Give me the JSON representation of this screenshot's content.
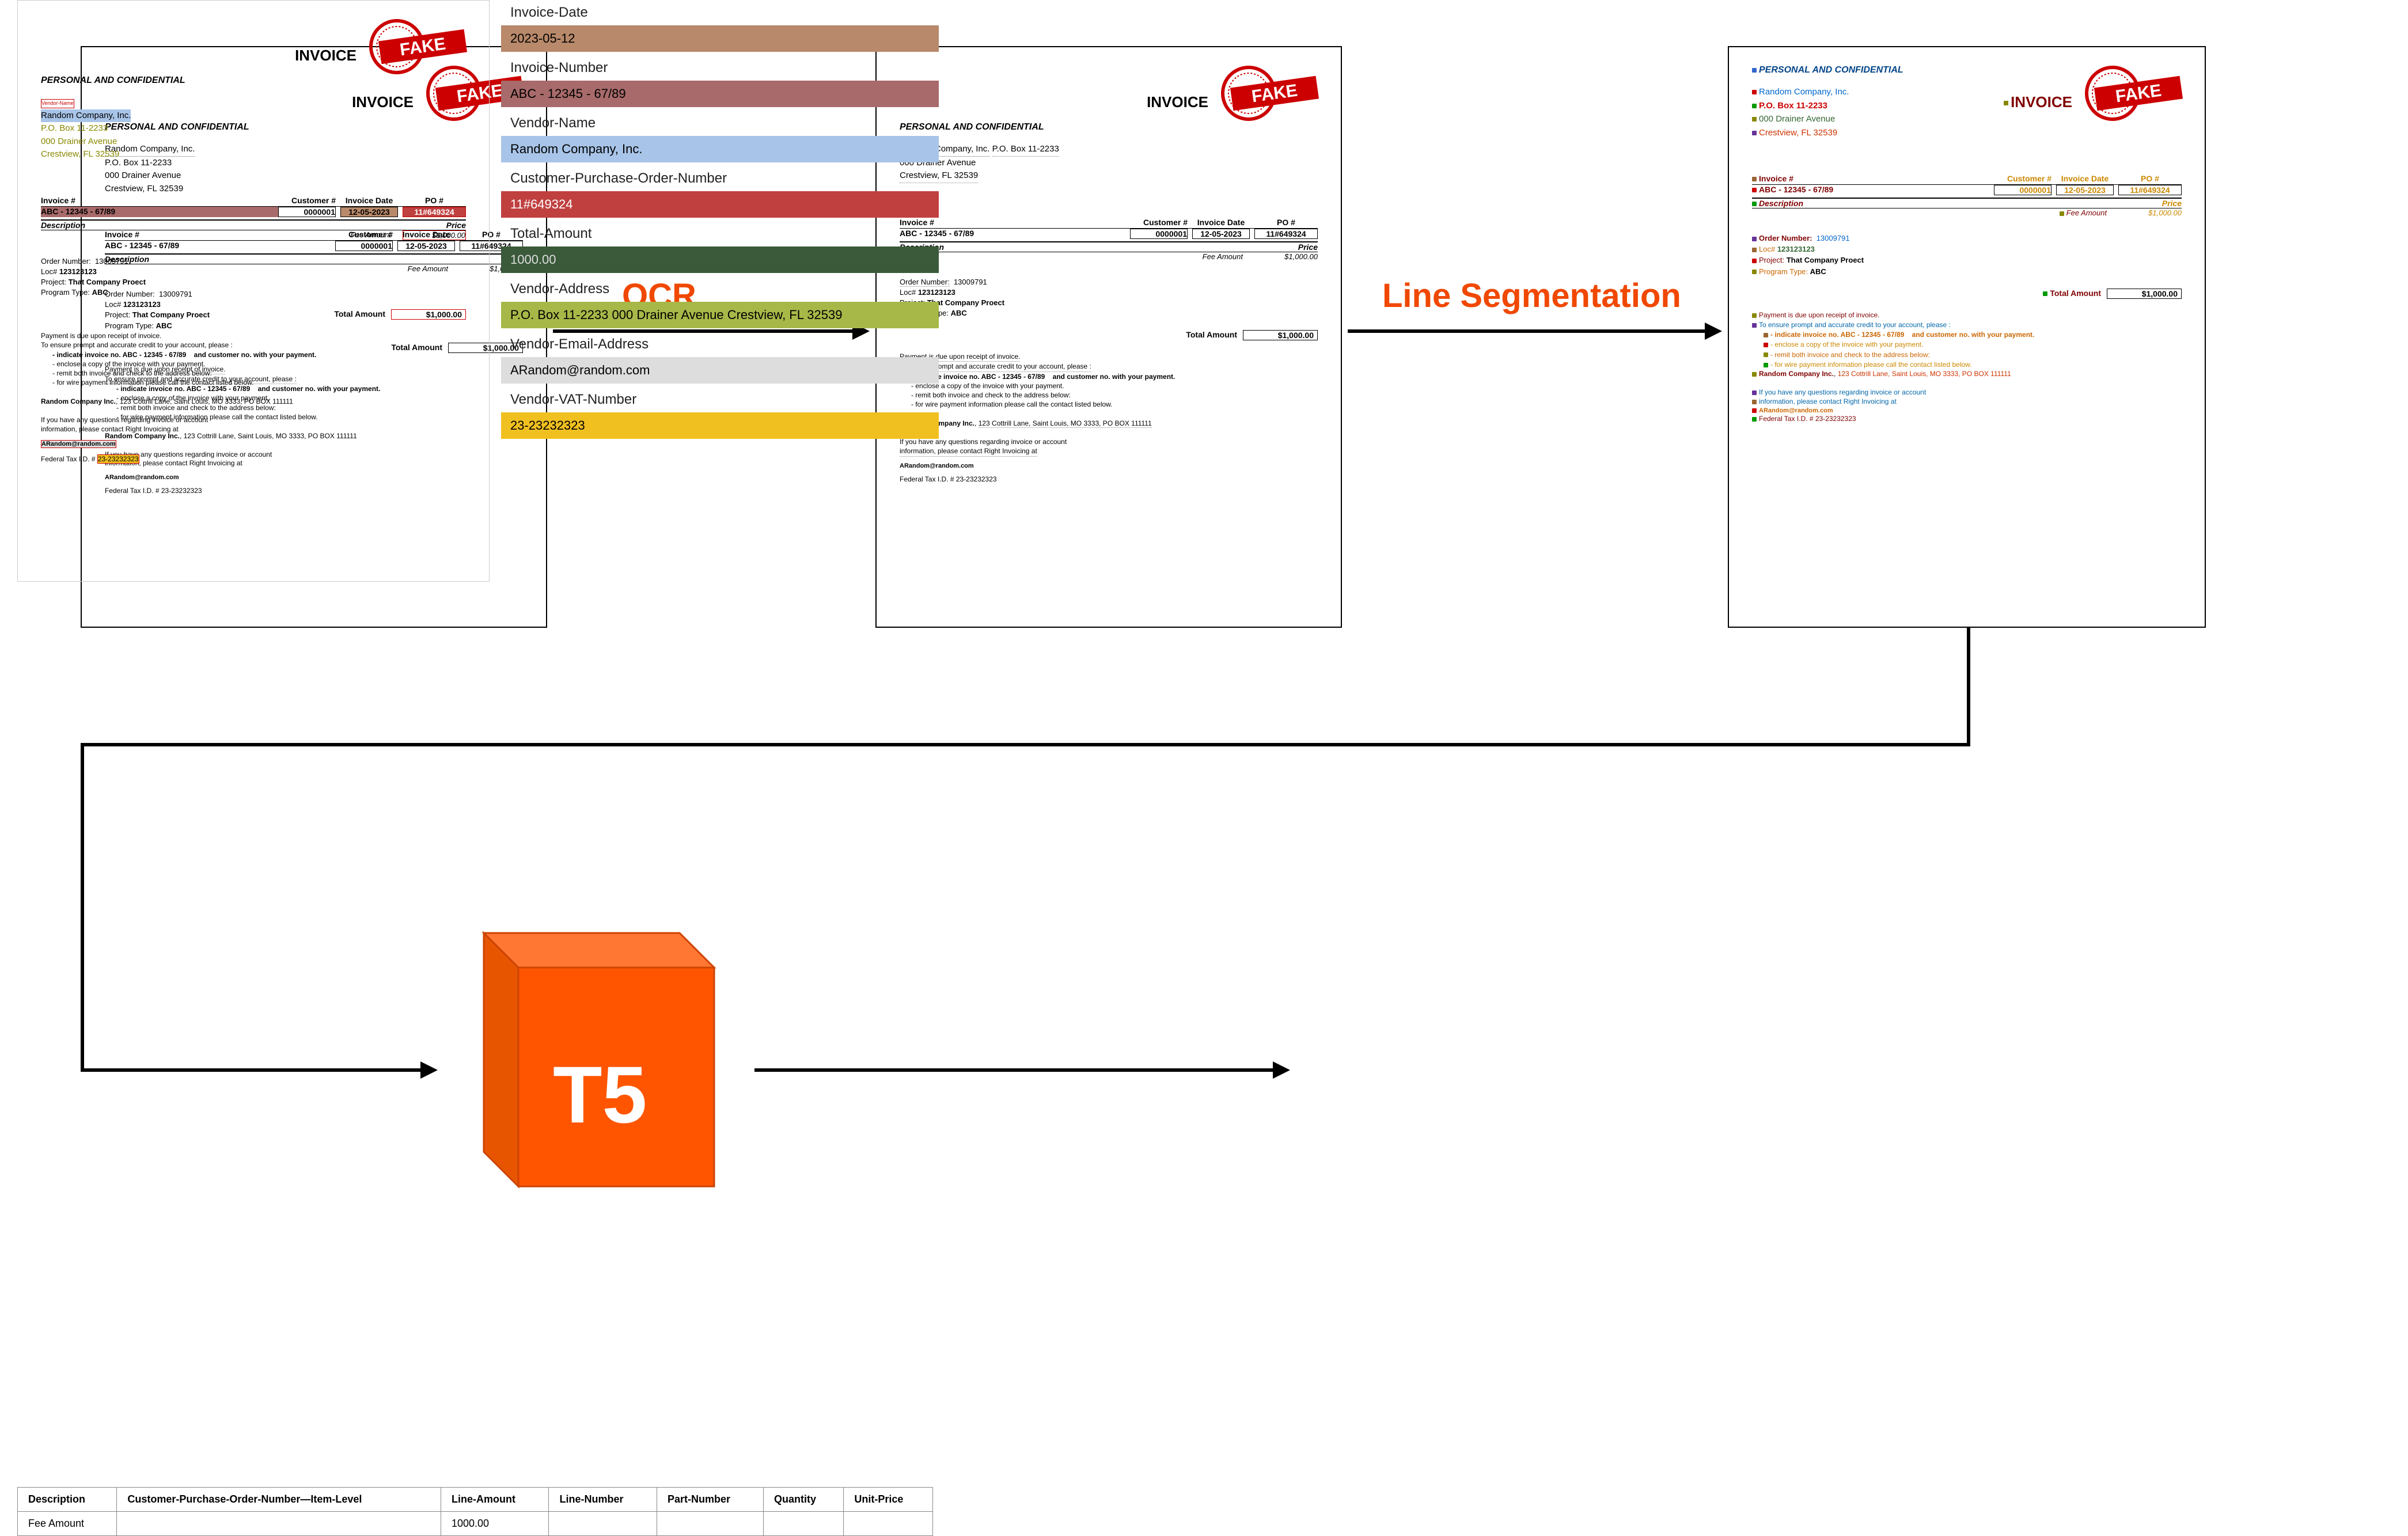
{
  "labels": {
    "ocr": "OCR",
    "line_segmentation": "Line Segmentation",
    "t5": "T5"
  },
  "invoice": {
    "title": "INVOICE",
    "stamp": "FAKE",
    "confidential": "PERSONAL AND CONFIDENTIAL",
    "company": "Random Company, Inc.",
    "po_box": "P.O. Box 11-2233",
    "street": "000 Drainer Avenue",
    "city": "Crestview, FL 32539",
    "th_invoice": "Invoice #",
    "th_customer": "Customer #",
    "th_inv_date": "Invoice Date",
    "th_po": "PO #",
    "invoice_no": "ABC - 12345 - 67/89",
    "customer_no": "0000001",
    "invoice_date": "12-05-2023",
    "po_no": "11#649324",
    "th_desc": "Description",
    "th_price": "Price",
    "fee_label": "Fee Amount",
    "fee_value": "$1,000.00",
    "order_label": "Order Number:",
    "order_value": "13009791",
    "loc_label": "Loc#",
    "loc_value": "123123123",
    "project_label": "Project:",
    "project_value": "That Company Proect",
    "program_label": "Program Type:",
    "program_value": "ABC",
    "total_label": "Total Amount",
    "total_value": "$1,000.00",
    "pay_1": "Payment is due upon receipt of invoice.",
    "pay_2": "To ensure prompt and accurate credit to your account, please :",
    "pay_3a": "- indicate invoice no. ABC - 12345 - 67/89",
    "pay_3b": "and customer no. with your payment.",
    "pay_4": "- enclose a copy of the invoice with your payment.",
    "pay_5": "- remit both invoice and check to the address below:",
    "pay_6": "- for wire payment information please call the contact listed below.",
    "company_full": "Random Company Inc.",
    "company_addr": "123 Cottrill Lane, Saint Louis, MO 3333, PO BOX 111111",
    "q_1": "If you have any questions regarding invoice or account",
    "q_2": "information, please contact Right Invoicing at",
    "email": "ARandom@random.com",
    "tax": "Federal Tax I.D. # 23-23232323"
  },
  "results": {
    "fields": [
      {
        "label": "Invoice-Date",
        "value": "2023-05-12",
        "class": "v-brown"
      },
      {
        "label": "Invoice-Number",
        "value": "ABC - 12345 - 67/89",
        "class": "v-maroon"
      },
      {
        "label": "Vendor-Name",
        "value": "Random Company, Inc.",
        "class": "v-blue"
      },
      {
        "label": "Customer-Purchase-Order-Number",
        "value": "11#649324",
        "class": "v-red"
      },
      {
        "label": "Total-Amount",
        "value": "1000.00",
        "class": "v-darkgreen"
      },
      {
        "label": "Vendor-Address",
        "value": "P.O. Box 11-2233 000 Drainer Avenue Crestview, FL 32539",
        "class": "v-olive"
      },
      {
        "label": "Vendor-Email-Address",
        "value": "ARandom@random.com",
        "class": "v-gray"
      },
      {
        "label": "Vendor-VAT-Number",
        "value": "23-23232323",
        "class": "v-yellow"
      }
    ],
    "table_headers": [
      "Description",
      "Customer-Purchase-Order-Number—Item-Level",
      "Line-Amount",
      "Line-Number",
      "Part-Number",
      "Quantity",
      "Unit-Price"
    ],
    "table_row": [
      "Fee Amount",
      "",
      "1000.00",
      "",
      "",
      "",
      ""
    ]
  }
}
